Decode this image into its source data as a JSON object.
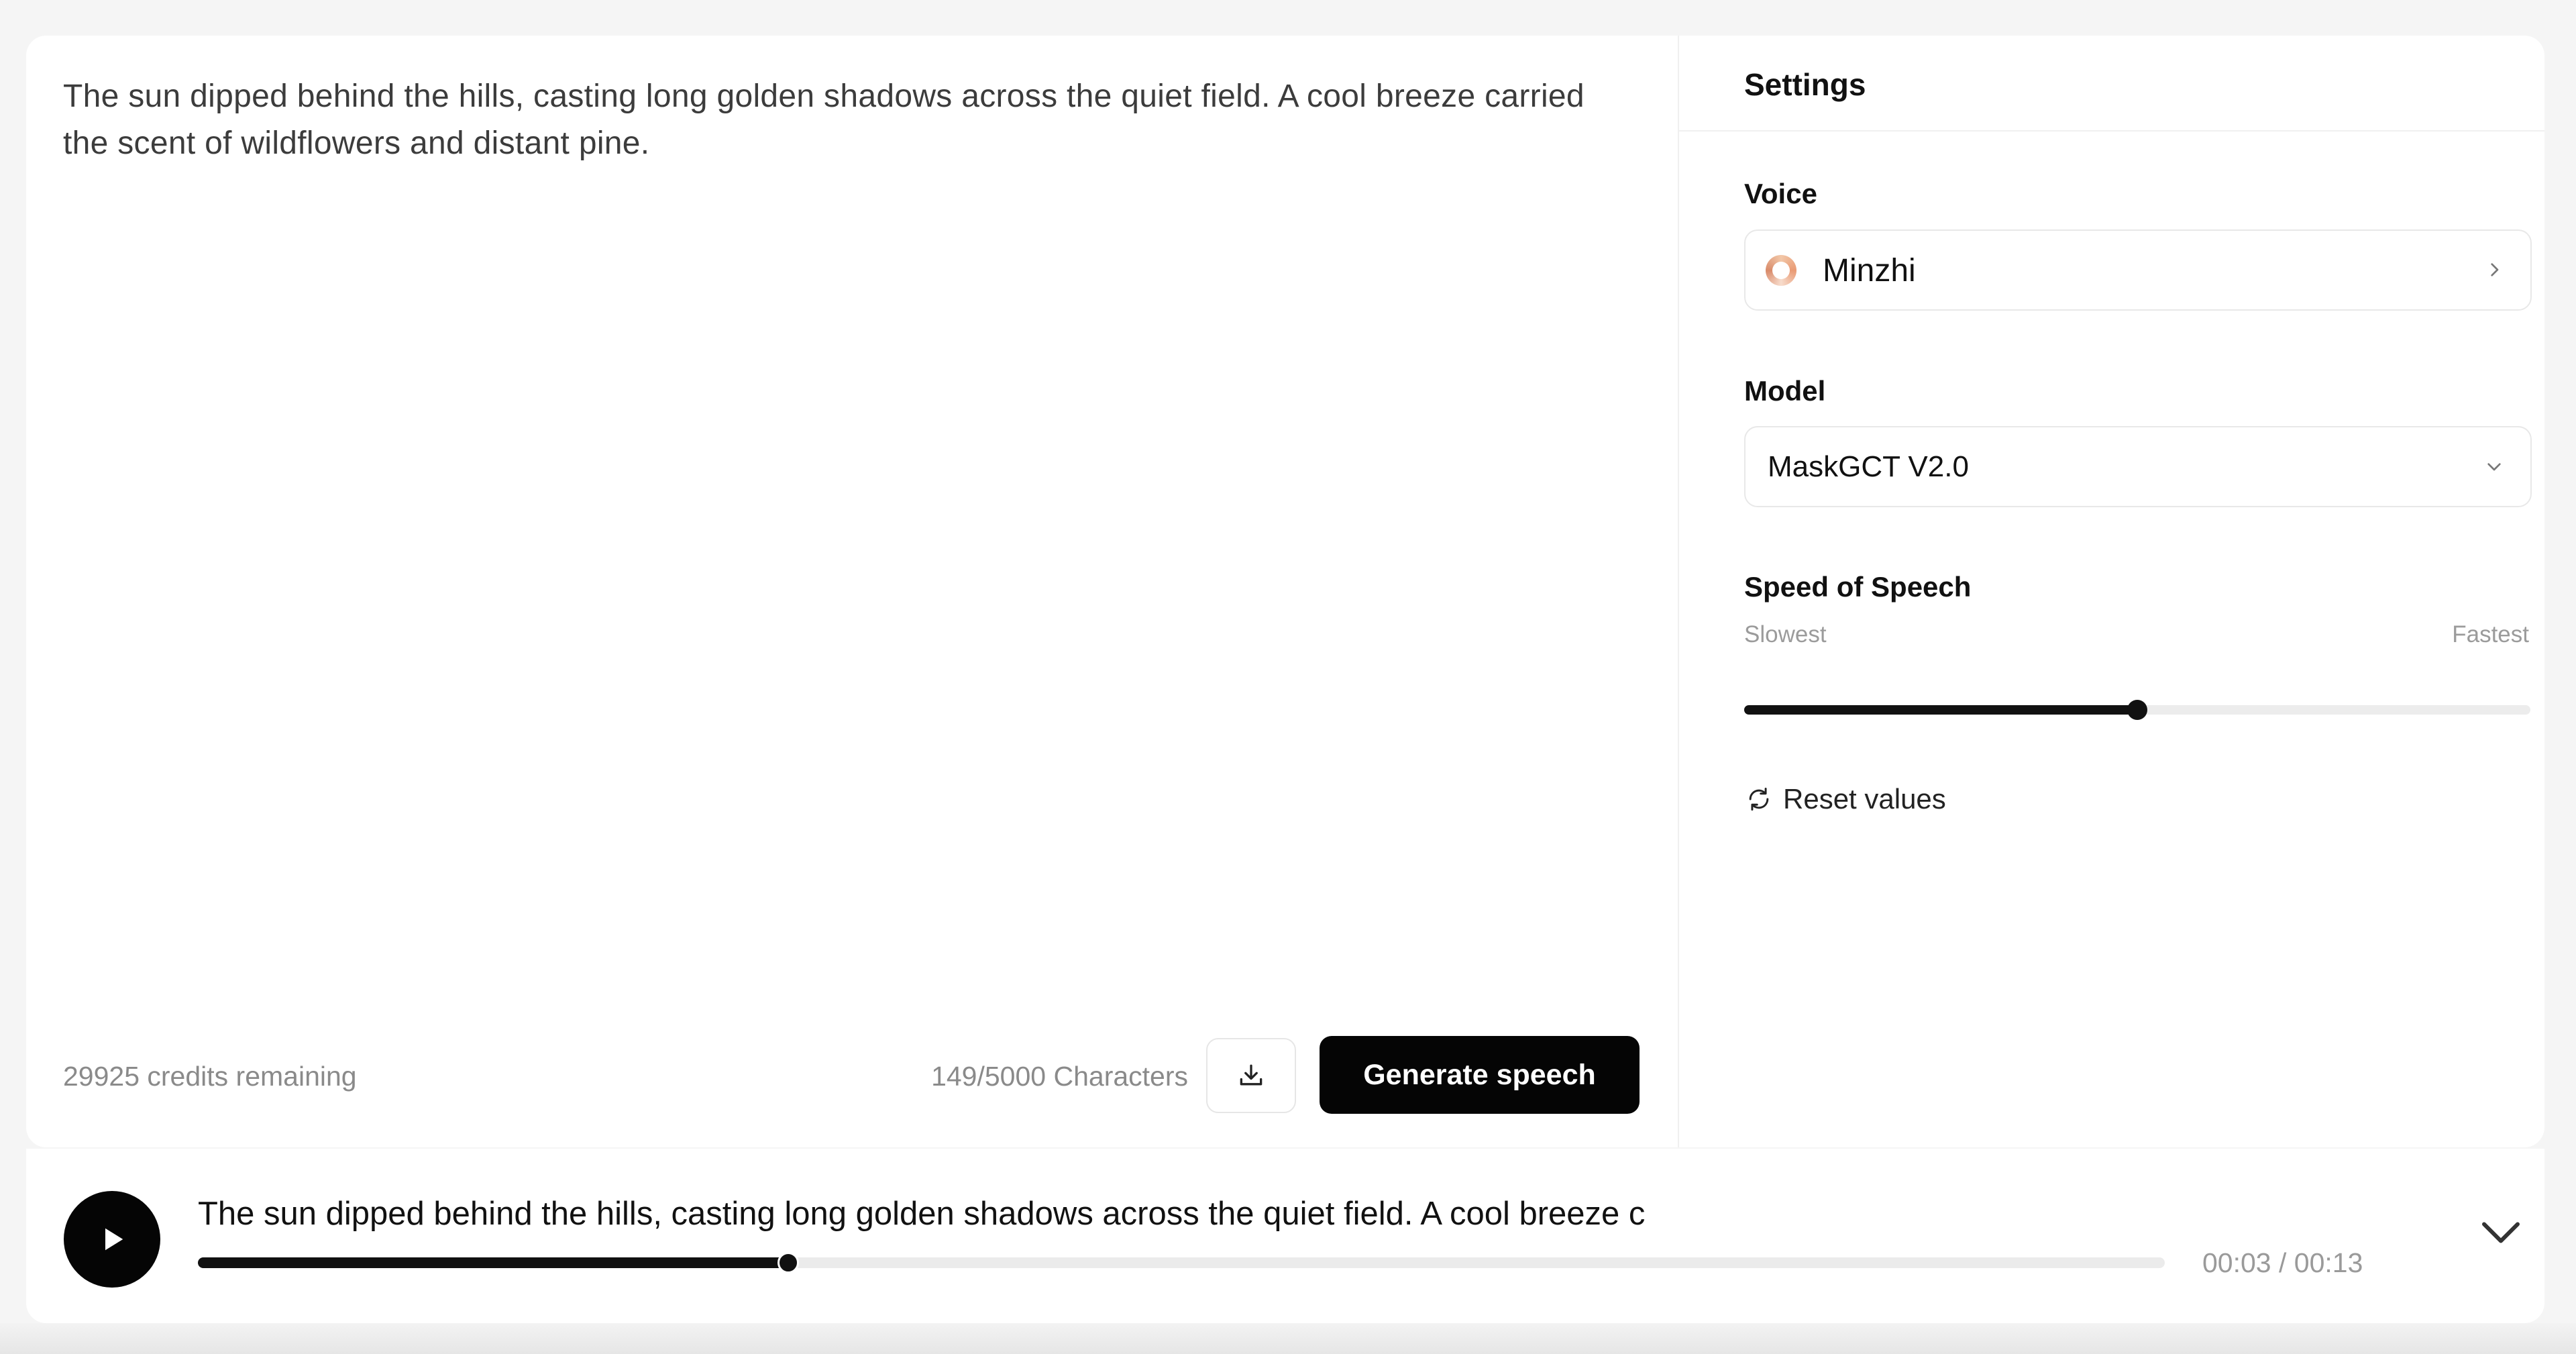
{
  "editor": {
    "text": "The sun dipped behind the hills, casting long golden shadows across the quiet field. A cool breeze carried the scent of wildflowers and distant pine.",
    "credits": "29925 credits remaining",
    "char_count": "149/5000 Characters",
    "download_icon": "download-icon",
    "generate_label": "Generate speech"
  },
  "settings": {
    "title": "Settings",
    "voice_label": "Voice",
    "voice_value": "Minzhi",
    "model_label": "Model",
    "model_value": "MaskGCT V2.0",
    "speed_label": "Speed of Speech",
    "speed_min_label": "Slowest",
    "speed_max_label": "Fastest",
    "speed_fraction": 0.5,
    "reset_label": "Reset values"
  },
  "player": {
    "text": "The sun dipped behind the hills, casting long golden shadows across the quiet field. A cool breeze c",
    "time": "00:03 / 00:13",
    "progress_fraction": 0.3
  },
  "colors": {
    "accent": "#050505",
    "muted_text": "#8a8a8a"
  }
}
